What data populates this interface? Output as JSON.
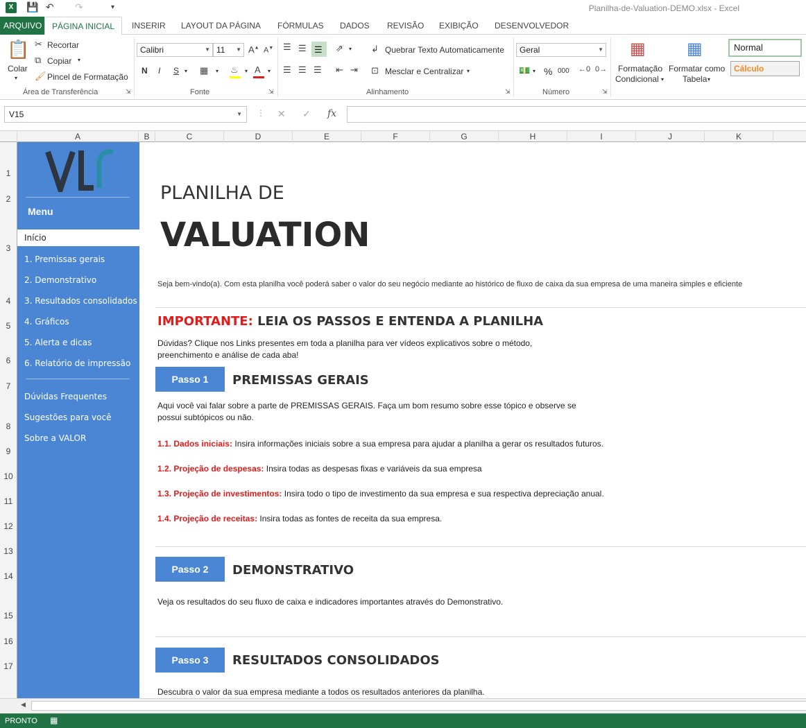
{
  "window": {
    "title": "Planilha-de-Valuation-DEMO.xlsx - Excel"
  },
  "tabs": [
    "ARQUIVO",
    "PÁGINA INICIAL",
    "INSERIR",
    "LAYOUT DA PÁGINA",
    "FÓRMULAS",
    "DADOS",
    "REVISÃO",
    "EXIBIÇÃO",
    "DESENVOLVEDOR"
  ],
  "ribbon": {
    "clipboard": {
      "paste": "Colar",
      "cut": "Recortar",
      "copy": "Copiar",
      "painter": "Pincel de Formatação",
      "label": "Área de Transferência"
    },
    "font": {
      "name": "Calibri",
      "size": "11",
      "label": "Fonte",
      "bold": "N",
      "italic": "I",
      "underline": "S"
    },
    "alignment": {
      "wrap": "Quebrar Texto Automaticamente",
      "merge": "Mesclar e Centralizar",
      "label": "Alinhamento"
    },
    "number": {
      "format": "Geral",
      "label": "Número",
      "percent": "%",
      "thousands": "000"
    },
    "styles": {
      "conditional_1": "Formatação",
      "conditional_2": "Condicional",
      "table_1": "Formatar como",
      "table_2": "Tabela",
      "normal": "Normal",
      "calc": "Cálculo"
    }
  },
  "formula_bar": {
    "namebox": "V15",
    "fx": "fx",
    "value": ""
  },
  "columns": [
    "A",
    "B",
    "C",
    "D",
    "E",
    "F",
    "G",
    "H",
    "I",
    "J",
    "K"
  ],
  "rows": [
    "1",
    "2",
    "3",
    "4",
    "5",
    "6",
    "7",
    "8",
    "9",
    "10",
    "11",
    "12",
    "13",
    "14",
    "15",
    "16",
    "17"
  ],
  "sidebar": {
    "menu_title": "Menu",
    "items": [
      "Início",
      "1. Premissas gerais",
      "2. Demonstrativo",
      "3. Resultados consolidados",
      "4. Gráficos",
      "5. Alerta e dicas",
      "6. Relatório de impressão"
    ],
    "extra": [
      "Dúvidas Frequentes",
      "Sugestões para você",
      "Sobre a VALOR"
    ]
  },
  "content": {
    "heading_small": "PLANILHA DE",
    "heading_big": "VALUATION",
    "welcome": "Seja bem-vindo(a). Com esta planilha você poderá saber o valor do seu negócio mediante ao histórico de fluxo de caixa da sua empresa de uma maneira simples e eficiente",
    "important_red": "IMPORTANTE:",
    "important_rest": " LEIA OS PASSOS E ENTENDA A PLANILHA",
    "doubts_1": "Dúvidas? Clique nos Links presentes em toda a planilha para ver vídeos explicativos sobre o método,",
    "doubts_2": "preenchimento e análise de cada aba!",
    "step1_label": "Passo 1",
    "step1_title": "PREMISSAS GERAIS",
    "step1_desc_1": "Aqui você vai falar sobre a parte de PREMISSAS GERAIS. Faça um bom resumo sobre esse tópico e observe se",
    "step1_desc_2": "possui subtópicos ou não.",
    "items": [
      {
        "label": "1.1. Dados iniciais:",
        "text": " Insira informações iniciais sobre a sua empresa para ajudar a planilha a gerar os resultados futuros."
      },
      {
        "label": "1.2. Projeção de despesas:",
        "text": " Insira todas as despesas fixas e variáveis da sua empresa"
      },
      {
        "label": "1.3. Projeção de investimentos:",
        "text": " Insira todo o tipo de investimento da sua empresa e sua respectiva depreciação anual."
      },
      {
        "label": "1.4. Projeção de receitas:",
        "text": " Insira todas as fontes de receita da sua empresa."
      }
    ],
    "step2_label": "Passo 2",
    "step2_title": "DEMONSTRATIVO",
    "step2_desc": "Veja os resultados do seu fluxo de caixa e indicadores importantes através do Demonstrativo.",
    "step3_label": "Passo 3",
    "step3_title": "RESULTADOS CONSOLIDADOS",
    "step3_desc": "Descubra o valor da sua empresa mediante a todos os resultados anteriores da planilha."
  },
  "status": {
    "text": "PRONTO"
  },
  "colors": {
    "excel_green": "#217346",
    "sidebar_blue": "#4a86d4",
    "important_red": "#e21b1b"
  }
}
